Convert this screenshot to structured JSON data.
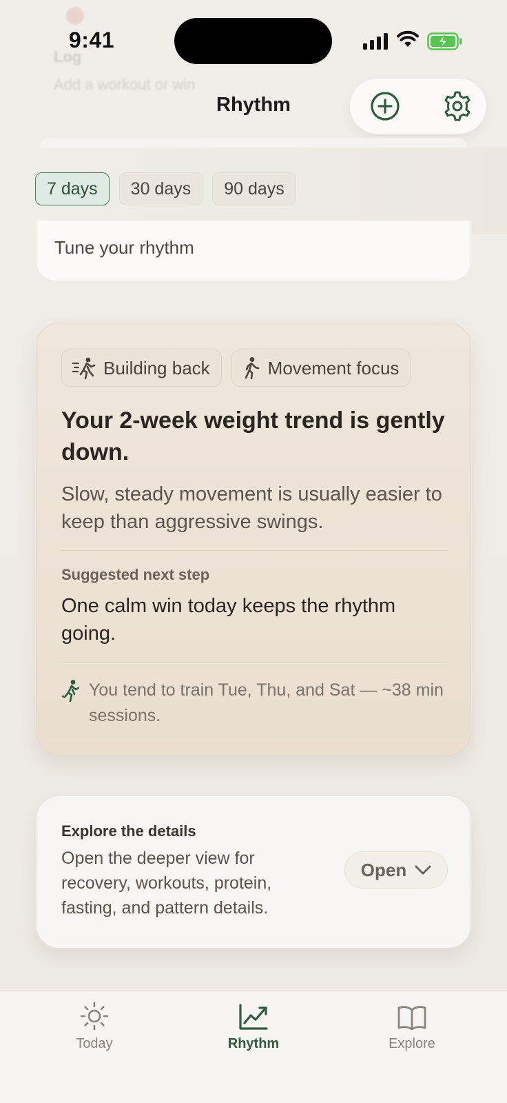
{
  "status_bar": {
    "time": "9:41"
  },
  "background_ghost": {
    "label": "Log",
    "hint": "Add a workout or win"
  },
  "header": {
    "title": "Rhythm"
  },
  "range_tabs": [
    {
      "label": "7 days",
      "active": true
    },
    {
      "label": "30 days",
      "active": false
    },
    {
      "label": "90 days",
      "active": false
    }
  ],
  "tune_card": {
    "text": "Tune your rhythm"
  },
  "insight": {
    "chips": [
      {
        "icon": "running-fast-icon",
        "label": "Building back"
      },
      {
        "icon": "walking-icon",
        "label": "Movement focus"
      }
    ],
    "title": "Your 2-week weight trend is gently down.",
    "subtitle": "Slow, steady movement is usually easier to keep than aggressive swings.",
    "step_label": "Suggested next step",
    "step_text": "One calm win today keeps the rhythm going.",
    "pattern_icon": "running-icon",
    "pattern_text": "You tend to train Tue, Thu, and Sat — ~38 min sessions."
  },
  "explore_card": {
    "label": "Explore the details",
    "text": "Open the deeper view for recovery, workouts, protein, fasting, and pattern details.",
    "button": "Open"
  },
  "tabbar": {
    "items": [
      {
        "label": "Today",
        "icon": "sun-icon",
        "active": false
      },
      {
        "label": "Rhythm",
        "icon": "trend-chart-icon",
        "active": true
      },
      {
        "label": "Explore",
        "icon": "book-icon",
        "active": false
      }
    ]
  },
  "colors": {
    "accent_green": "#2f5b3f",
    "battery_green": "#58c552",
    "card_beige": "#ede4d7"
  }
}
